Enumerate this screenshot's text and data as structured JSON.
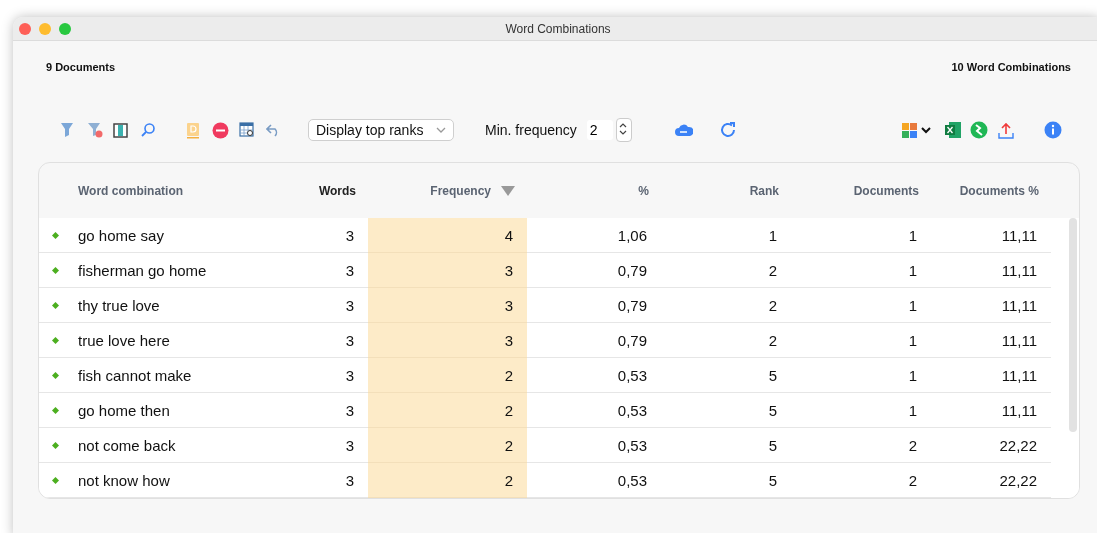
{
  "window": {
    "title": "Word Combinations"
  },
  "summary": {
    "documents": "9 Documents",
    "combinations": "10 Word Combinations"
  },
  "toolbar": {
    "display_mode": "Display top ranks",
    "min_frequency_label": "Min. frequency",
    "min_frequency": "2"
  },
  "table": {
    "columns": [
      {
        "label": "Word combination",
        "sorted": false,
        "highlighted": false
      },
      {
        "label": "Words",
        "sorted": false,
        "highlighted": true
      },
      {
        "label": "Frequency",
        "sorted": true,
        "highlighted": false
      },
      {
        "label": "%",
        "sorted": false,
        "highlighted": false
      },
      {
        "label": "Rank",
        "sorted": false,
        "highlighted": false
      },
      {
        "label": "Documents",
        "sorted": false,
        "highlighted": false
      },
      {
        "label": "Documents %",
        "sorted": false,
        "highlighted": false
      }
    ],
    "rows": [
      [
        "go home say",
        "3",
        "4",
        "1,06",
        "1",
        "1",
        "11,11"
      ],
      [
        "fisherman go home",
        "3",
        "3",
        "0,79",
        "2",
        "1",
        "11,11"
      ],
      [
        "thy true love",
        "3",
        "3",
        "0,79",
        "2",
        "1",
        "11,11"
      ],
      [
        "true love here",
        "3",
        "3",
        "0,79",
        "2",
        "1",
        "11,11"
      ],
      [
        "fish cannot make",
        "3",
        "2",
        "0,53",
        "5",
        "1",
        "11,11"
      ],
      [
        "go home then",
        "3",
        "2",
        "0,53",
        "5",
        "1",
        "11,11"
      ],
      [
        "not come back",
        "3",
        "2",
        "0,53",
        "5",
        "2",
        "22,22"
      ],
      [
        "not know how",
        "3",
        "2",
        "0,53",
        "5",
        "2",
        "22,22"
      ]
    ]
  }
}
